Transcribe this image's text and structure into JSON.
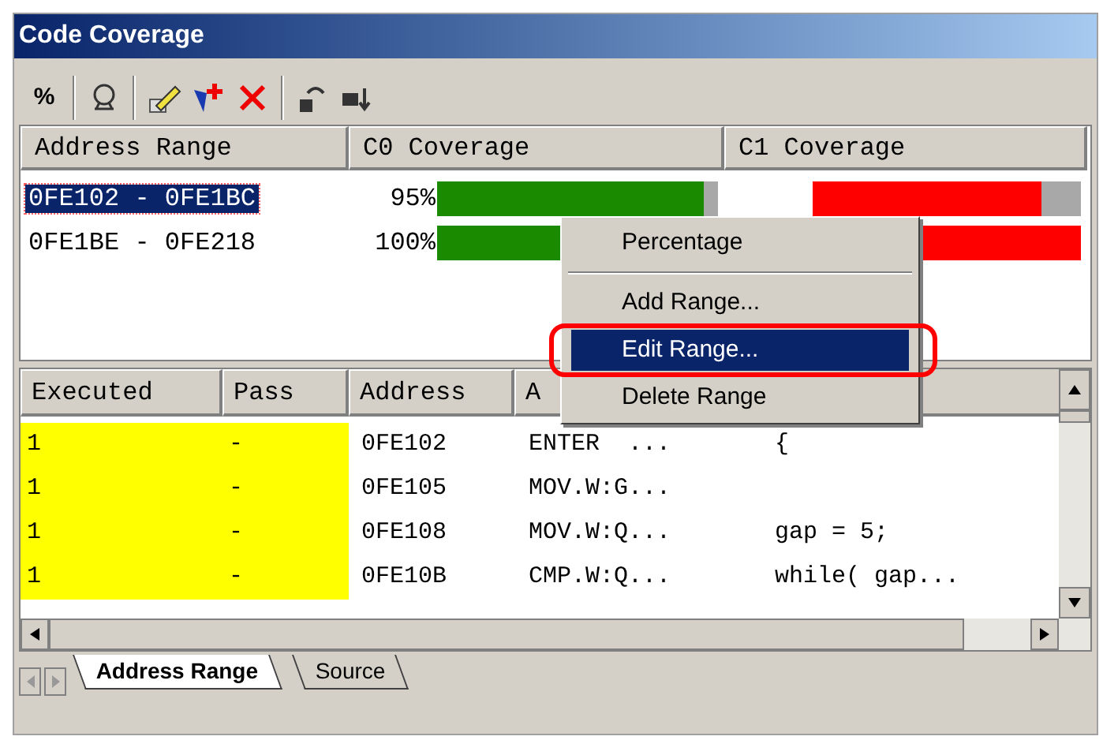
{
  "window": {
    "title": "Code Coverage"
  },
  "toolbar": {
    "percent_label": "%"
  },
  "ranges": {
    "columns": [
      {
        "label": "Address Range"
      },
      {
        "label": "C0 Coverage",
        "color": "#1a8a00"
      },
      {
        "label": "C1 Coverage",
        "color": "#ff0000"
      }
    ],
    "rows": [
      {
        "range": "0FE102 - 0FE1BC",
        "selected": true,
        "c0": {
          "reading": "95%",
          "level": 0.95
        },
        "c1": {
          "level": 0.85
        }
      },
      {
        "range": "0FE1BE - 0FE218",
        "selected": false,
        "c0": {
          "reading": "100%",
          "level": 1
        },
        "c1": {
          "level": 1
        }
      }
    ]
  },
  "context_menu": {
    "items": [
      {
        "kind": "item",
        "label": "Percentage",
        "selected": false,
        "circled": false
      },
      {
        "kind": "separator"
      },
      {
        "kind": "item",
        "label": "Add Range...",
        "selected": false,
        "circled": false
      },
      {
        "kind": "item",
        "label": "Edit Range...",
        "selected": true,
        "circled": true
      },
      {
        "kind": "item",
        "label": "Delete Range",
        "selected": false,
        "circled": false
      }
    ]
  },
  "source": {
    "columns": [
      "Executed",
      "Pass",
      "Address",
      "A"
    ],
    "rows": [
      [
        "1",
        "-",
        "0FE102",
        "ENTER  ...",
        "{"
      ],
      [
        "1",
        "-",
        "0FE105",
        "MOV.W:G..."
      ],
      [
        "1",
        "-",
        "0FE108",
        "MOV.W:Q...",
        "gap = 5;"
      ],
      [
        "1",
        "-",
        "0FE10B",
        "CMP.W:Q...",
        "while( gap..."
      ]
    ]
  },
  "tabs": [
    {
      "label": "Address Range",
      "selected": true
    },
    {
      "label": "Source",
      "selected": false
    }
  ]
}
